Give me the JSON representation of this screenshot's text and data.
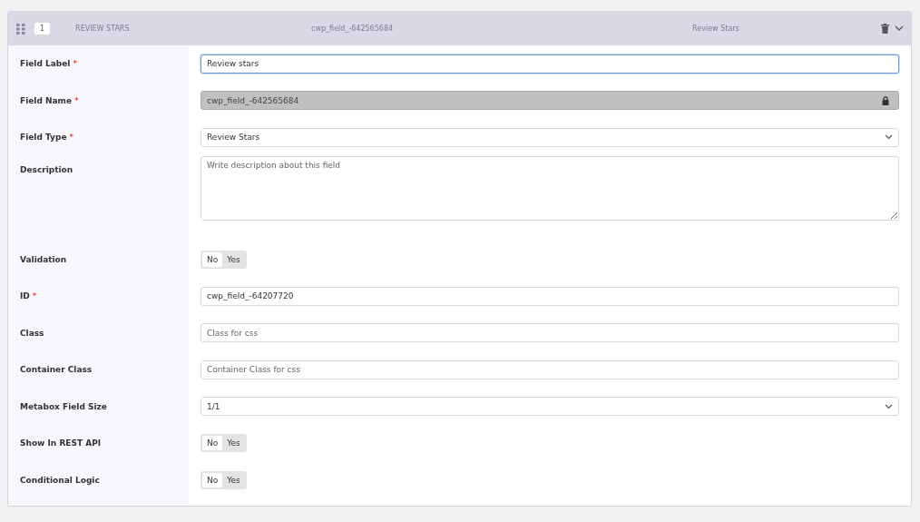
{
  "header": {
    "order": "1",
    "title": "REVIEW STARS",
    "field_name": "cwp_field_-642565684",
    "field_type": "Review Stars"
  },
  "fields": [
    {
      "kind": "text",
      "label": "Field Label",
      "required_mark": "*",
      "value": "Review stars",
      "focused": true
    },
    {
      "kind": "locked",
      "label": "Field Name",
      "required_mark": "*",
      "value": "cwp_field_-642565684"
    },
    {
      "kind": "select",
      "label": "Field Type",
      "required_mark": "*",
      "value": "Review Stars"
    },
    {
      "kind": "textarea",
      "label": "Description",
      "placeholder": "Write description about this field"
    },
    {
      "kind": "toggle",
      "label": "Validation",
      "options": [
        {
          "label": "No",
          "selected": true
        },
        {
          "label": "Yes",
          "selected": false
        }
      ]
    },
    {
      "kind": "text",
      "label": "ID",
      "required_mark": "*",
      "value": "cwp_field_-64207720",
      "focused": false
    },
    {
      "kind": "text",
      "label": "Class",
      "placeholder": "Class for css",
      "focused": false
    },
    {
      "kind": "text",
      "label": "Container Class",
      "placeholder": "Container Class for css",
      "focused": false
    },
    {
      "kind": "select",
      "label": "Metabox Field Size",
      "value": "1/1"
    },
    {
      "kind": "toggle",
      "label": "Show In REST API",
      "options": [
        {
          "label": "No",
          "selected": true
        },
        {
          "label": "Yes",
          "selected": false
        }
      ]
    },
    {
      "kind": "toggle",
      "label": "Conditional Logic",
      "options": [
        {
          "label": "No",
          "selected": true
        },
        {
          "label": "Yes",
          "selected": false
        }
      ]
    }
  ]
}
